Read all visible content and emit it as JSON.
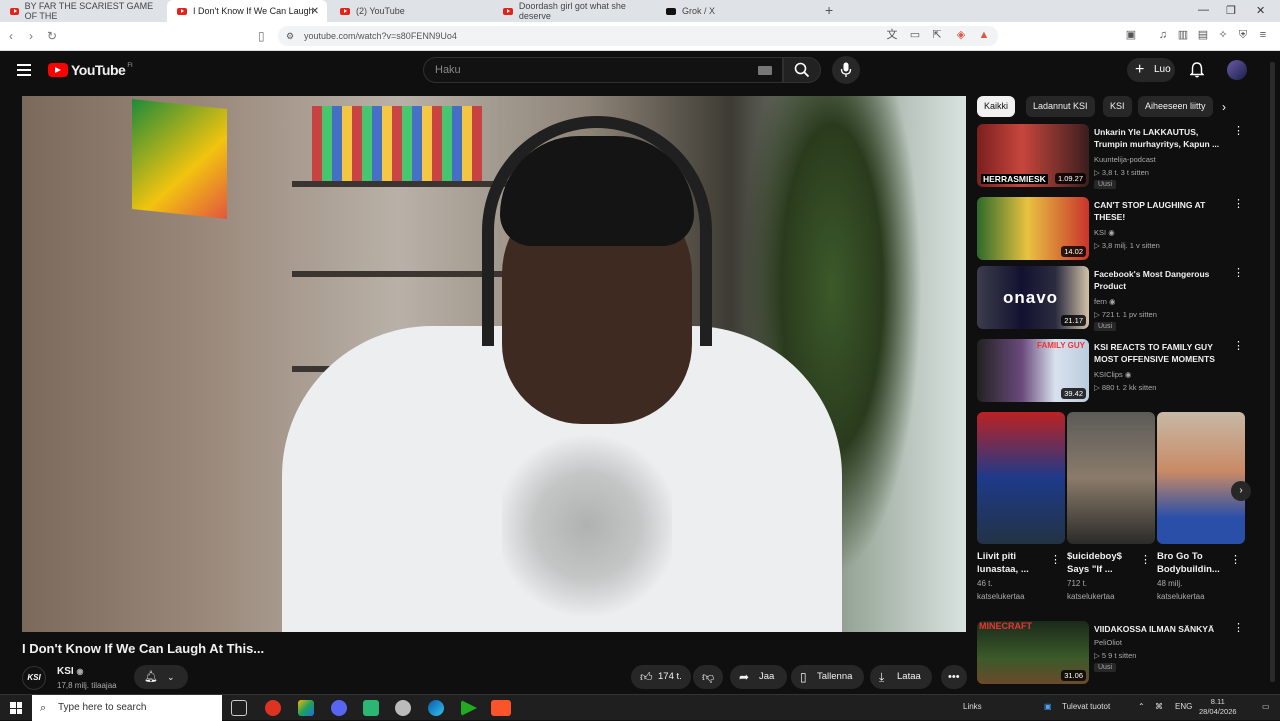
{
  "browser": {
    "tabs": [
      {
        "title": "BY FAR THE SCARIEST GAME OF THE",
        "icon": "youtube-icon"
      },
      {
        "title": "I Don't Know If We Can Laugh",
        "icon": "youtube-icon",
        "active": true
      },
      {
        "title": "(2) YouTube",
        "icon": "youtube-icon"
      },
      {
        "title": "Doordash girl got what she deserve",
        "icon": "youtube-icon"
      },
      {
        "title": "Grok / X",
        "icon": "x-icon"
      }
    ],
    "new_tab": "+",
    "url": "youtube.com/watch?v=s80FENN9Uo4"
  },
  "youtube": {
    "logo_text": "YouTube",
    "logo_country": "FI",
    "search_placeholder": "Haku",
    "create_label": "Luo"
  },
  "video": {
    "title": "I Don't Know If We Can Laugh At This...",
    "channel": "KSI",
    "channel_avatar_text": "KSI",
    "subscribers": "17,8 milj. tilaajaa",
    "likes": "174 t.",
    "share_label": "Jaa",
    "save_label": "Tallenna",
    "download_label": "Lataa"
  },
  "chips": [
    "Kaikki",
    "Ladannut KSI",
    "KSI",
    "Aiheeseen liitty"
  ],
  "recommendations": [
    {
      "title": "Unkarin Yle LAKKAUTUS, Trumpin murhayritys, Kapun ...",
      "channel": "Kuuntelija-podcast",
      "meta": "▷ 3,8 t.   3 t sitten",
      "badge": "Uusi",
      "duration": "1.09.27",
      "overlay": "HERRASMIESK"
    },
    {
      "title": "CAN'T STOP LAUGHING AT THESE!",
      "channel": "KSI",
      "meta": "▷ 3,8 milj.   1 v sitten",
      "badge": "",
      "duration": "14.02",
      "overlay": ""
    },
    {
      "title": "Facebook's Most Dangerous Product",
      "channel": "fern",
      "meta": "▷ 721 t.   1 pv sitten",
      "badge": "Uusi",
      "duration": "21.17",
      "overlay": "onavo"
    },
    {
      "title": "KSI REACTS TO FAMILY GUY MOST OFFENSIVE MOMENTS",
      "channel": "KSIClips",
      "meta": "▷ 880 t.   2 kk sitten",
      "badge": "",
      "duration": "39.42",
      "overlay": "FAMILY GUY"
    },
    {
      "title": "VIIDAKOSSA ILMAN SÄNKYÄ",
      "channel": "PeliOliot",
      "meta": "▷ 5   9 t sitten",
      "badge": "Uusi",
      "duration": "31.06",
      "overlay": "MINECRAFT"
    }
  ],
  "shorts": [
    {
      "title": "Liivit piti lunastaa, ...",
      "views": "46 t.",
      "views_label": "katselukertaa"
    },
    {
      "title": "$uicideboy$ Says \"If ...",
      "views": "712 t.",
      "views_label": "katselukertaa"
    },
    {
      "title": "Bro Go To Bodybuildin...",
      "views": "48 milj.",
      "views_label": "katselukertaa"
    }
  ],
  "taskbar": {
    "search_placeholder": "Type here to search",
    "links_label": "Links",
    "weather": "Tulevat tuotot",
    "language": "ENG",
    "time": "8.11",
    "date": "28/04/2026"
  }
}
